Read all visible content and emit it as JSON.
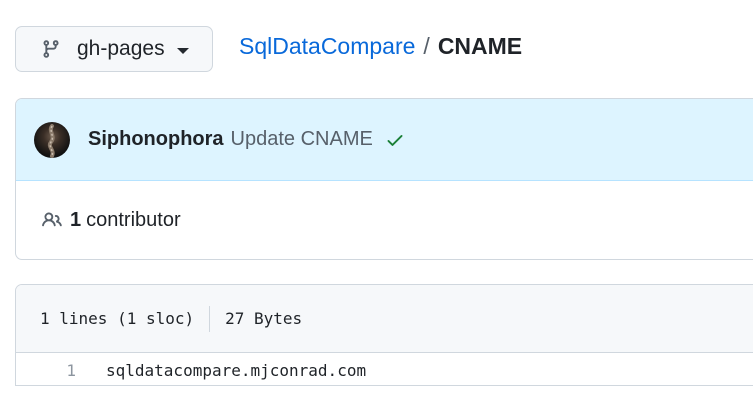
{
  "branch": {
    "label": "gh-pages",
    "icon": "git-branch-icon"
  },
  "breadcrumb": {
    "repo": "SqlDataCompare",
    "separator": "/",
    "file": "CNAME"
  },
  "commit": {
    "author": "Siphonophora",
    "message": "Update CNAME",
    "status": "success",
    "status_color": "#1a7f37"
  },
  "contributors": {
    "count": "1",
    "label": "contributor"
  },
  "file": {
    "lines_info": "1 lines (1 sloc)",
    "size": "27 Bytes",
    "lines": [
      {
        "number": "1",
        "code": "sqldatacompare.mjconrad.com"
      }
    ]
  },
  "colors": {
    "link": "#0969da",
    "commit_header_bg": "#ddf4ff",
    "border": "#d0d7de"
  }
}
